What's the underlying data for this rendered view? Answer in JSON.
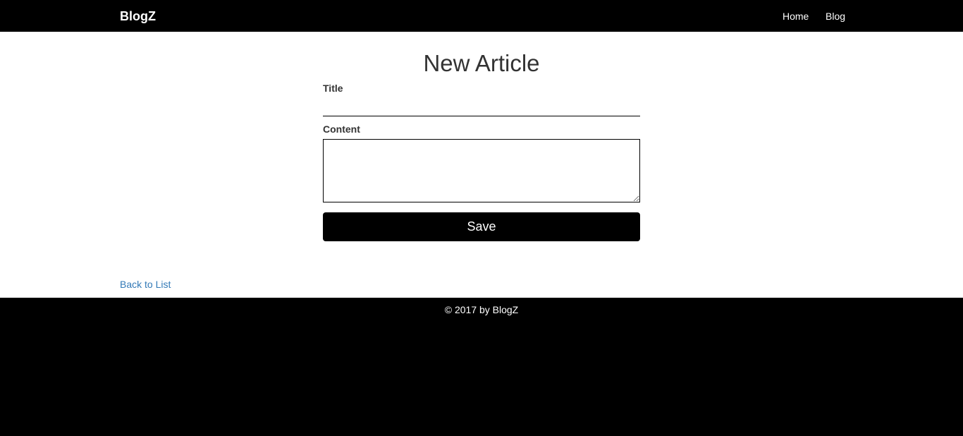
{
  "navbar": {
    "brand": "BlogZ",
    "links": [
      {
        "label": "Home"
      },
      {
        "label": "Blog"
      }
    ]
  },
  "form": {
    "heading": "New Article",
    "title_label": "Title",
    "title_value": "",
    "content_label": "Content",
    "content_value": "",
    "save_label": "Save"
  },
  "back_link": "Back to List",
  "footer": {
    "text": "© 2017 by BlogZ"
  },
  "colors": {
    "navbar_bg": "#000000",
    "link_blue": "#337ab7",
    "button_bg": "#000000"
  }
}
